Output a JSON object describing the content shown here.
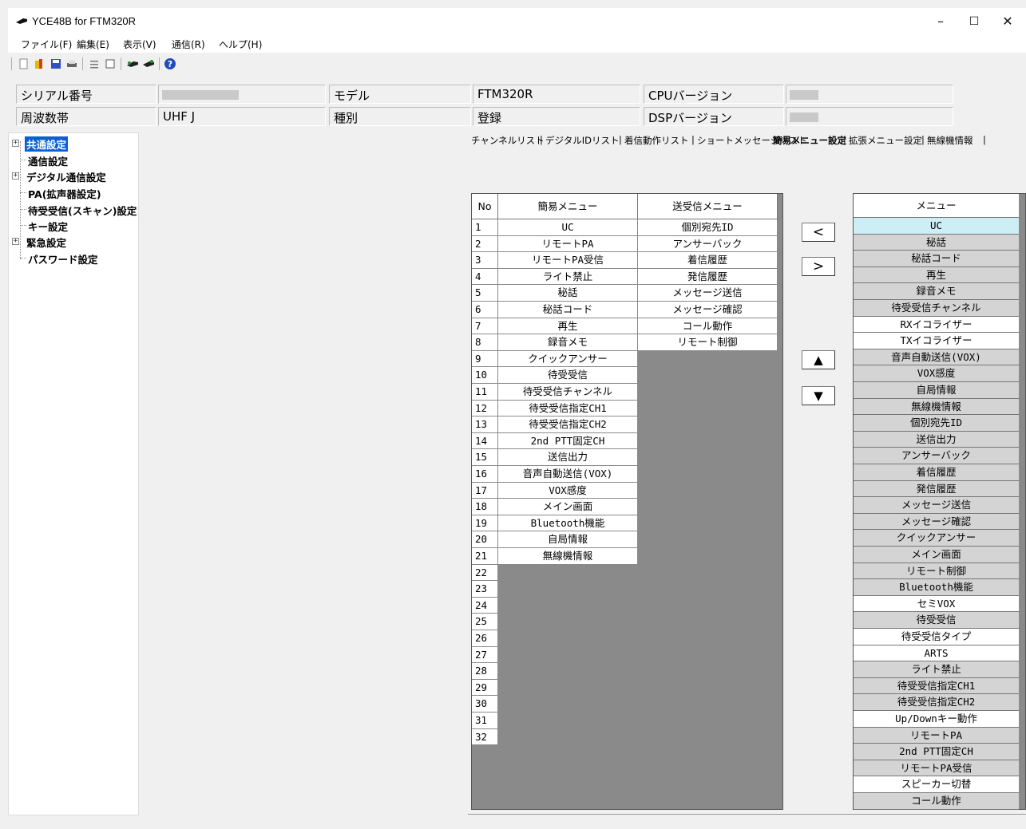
{
  "window": {
    "title": "YCE48B for FTM320R",
    "minimize": "–",
    "maximize": "☐",
    "close": "✕"
  },
  "menu": [
    "ファイル(F)",
    "編集(E)",
    "表示(V)",
    "通信(R)",
    "ヘルプ(H)"
  ],
  "toolbar": {
    "icons": [
      "new-icon",
      "open-icon",
      "save-icon",
      "print-icon",
      "list-icon",
      "window-icon",
      "read-radio-icon",
      "write-radio-icon",
      "help-icon"
    ]
  },
  "info": {
    "serial_label": "シリアル番号",
    "serial_value": "",
    "model_label": "モデル",
    "model_value": "FTM320R",
    "cpu_label": "CPUバージョン",
    "cpu_value": "",
    "band_label": "周波数帯",
    "band_value": "UHF J",
    "type_label": "種別",
    "type_value": "登録",
    "dsp_label": "DSPバージョン",
    "dsp_value": ""
  },
  "tree": [
    {
      "label": "共通設定",
      "expander": "+",
      "selected": true
    },
    {
      "label": "通信設定"
    },
    {
      "label": "デジタル通信設定",
      "expander": "+"
    },
    {
      "label": "PA(拡声器設定)"
    },
    {
      "label": "待受受信(スキャン)設定"
    },
    {
      "label": "キー設定"
    },
    {
      "label": "緊急設定",
      "expander": "+"
    },
    {
      "label": "パスワード設定"
    }
  ],
  "tabs": [
    "チャンネルリスト",
    "デジタルIDリスト",
    "着信動作リスト",
    "ショートメッセージリスト",
    "簡易メニュー設定",
    "拡張メニュー設定",
    "無線機情報"
  ],
  "active_tab": "簡易メニュー設定",
  "table": {
    "col_no": "No",
    "col_simple": "簡易メニュー",
    "col_txrx": "送受信メニュー",
    "rows": [
      {
        "no": "1",
        "simple": "UC",
        "txrx": "個別宛先ID"
      },
      {
        "no": "2",
        "simple": "リモートPA",
        "txrx": "アンサーバック"
      },
      {
        "no": "3",
        "simple": "リモートPA受信",
        "txrx": "着信履歴"
      },
      {
        "no": "4",
        "simple": "ライト禁止",
        "txrx": "発信履歴"
      },
      {
        "no": "5",
        "simple": "秘話",
        "txrx": "メッセージ送信"
      },
      {
        "no": "6",
        "simple": "秘話コード",
        "txrx": "メッセージ確認"
      },
      {
        "no": "7",
        "simple": "再生",
        "txrx": "コール動作"
      },
      {
        "no": "8",
        "simple": "録音メモ",
        "txrx": "リモート制御"
      },
      {
        "no": "9",
        "simple": "クイックアンサー",
        "txrx": ""
      },
      {
        "no": "10",
        "simple": "待受受信",
        "txrx": ""
      },
      {
        "no": "11",
        "simple": "待受受信チャンネル",
        "txrx": ""
      },
      {
        "no": "12",
        "simple": "待受受信指定CH1",
        "txrx": ""
      },
      {
        "no": "13",
        "simple": "待受受信指定CH2",
        "txrx": ""
      },
      {
        "no": "14",
        "simple": "2nd PTT固定CH",
        "txrx": ""
      },
      {
        "no": "15",
        "simple": "送信出力",
        "txrx": ""
      },
      {
        "no": "16",
        "simple": "音声自動送信(VOX)",
        "txrx": ""
      },
      {
        "no": "17",
        "simple": "VOX感度",
        "txrx": ""
      },
      {
        "no": "18",
        "simple": "メイン画面",
        "txrx": ""
      },
      {
        "no": "19",
        "simple": "Bluetooth機能",
        "txrx": ""
      },
      {
        "no": "20",
        "simple": "自局情報",
        "txrx": ""
      },
      {
        "no": "21",
        "simple": "無線機情報",
        "txrx": ""
      },
      {
        "no": "22",
        "simple": "",
        "txrx": ""
      },
      {
        "no": "23",
        "simple": "",
        "txrx": ""
      },
      {
        "no": "24",
        "simple": "",
        "txrx": ""
      },
      {
        "no": "25",
        "simple": "",
        "txrx": ""
      },
      {
        "no": "26",
        "simple": "",
        "txrx": ""
      },
      {
        "no": "27",
        "simple": "",
        "txrx": ""
      },
      {
        "no": "28",
        "simple": "",
        "txrx": ""
      },
      {
        "no": "29",
        "simple": "",
        "txrx": ""
      },
      {
        "no": "30",
        "simple": "",
        "txrx": ""
      },
      {
        "no": "31",
        "simple": "",
        "txrx": ""
      },
      {
        "no": "32",
        "simple": "",
        "txrx": ""
      }
    ]
  },
  "buttons": {
    "left": "<",
    "right": ">",
    "up": "▲",
    "down": "▼"
  },
  "menu_list": {
    "header": "メニュー",
    "items": [
      {
        "label": "UC",
        "style": "sel"
      },
      {
        "label": "秘話",
        "style": "grey"
      },
      {
        "label": "秘話コード",
        "style": "grey"
      },
      {
        "label": "再生",
        "style": "grey"
      },
      {
        "label": "録音メモ",
        "style": "grey"
      },
      {
        "label": "待受受信チャンネル",
        "style": "grey"
      },
      {
        "label": "RXイコライザー",
        "style": "white"
      },
      {
        "label": "TXイコライザー",
        "style": "white"
      },
      {
        "label": "音声自動送信(VOX)",
        "style": "grey"
      },
      {
        "label": "VOX感度",
        "style": "grey"
      },
      {
        "label": "自局情報",
        "style": "grey"
      },
      {
        "label": "無線機情報",
        "style": "grey"
      },
      {
        "label": "個別宛先ID",
        "style": "grey"
      },
      {
        "label": "送信出力",
        "style": "grey"
      },
      {
        "label": "アンサーバック",
        "style": "grey"
      },
      {
        "label": "着信履歴",
        "style": "grey"
      },
      {
        "label": "発信履歴",
        "style": "grey"
      },
      {
        "label": "メッセージ送信",
        "style": "grey"
      },
      {
        "label": "メッセージ確認",
        "style": "grey"
      },
      {
        "label": "クイックアンサー",
        "style": "grey"
      },
      {
        "label": "メイン画面",
        "style": "grey"
      },
      {
        "label": "リモート制御",
        "style": "grey"
      },
      {
        "label": "Bluetooth機能",
        "style": "grey"
      },
      {
        "label": "セミVOX",
        "style": "white"
      },
      {
        "label": "待受受信",
        "style": "grey"
      },
      {
        "label": "待受受信タイプ",
        "style": "white"
      },
      {
        "label": "ARTS",
        "style": "white"
      },
      {
        "label": "ライト禁止",
        "style": "grey"
      },
      {
        "label": "待受受信指定CH1",
        "style": "grey"
      },
      {
        "label": "待受受信指定CH2",
        "style": "grey"
      },
      {
        "label": "Up/Downキー動作",
        "style": "white"
      },
      {
        "label": "リモートPA",
        "style": "grey"
      },
      {
        "label": "2nd PTT固定CH",
        "style": "grey"
      },
      {
        "label": "リモートPA受信",
        "style": "grey"
      },
      {
        "label": "スピーカー切替",
        "style": "white"
      },
      {
        "label": "コール動作",
        "style": "grey"
      }
    ]
  },
  "colors": {
    "selection": "#0a5fd6",
    "list_selected": "#cdeef5",
    "empty_cell": "#8a8a8a",
    "list_grey": "#d4d4d4"
  }
}
